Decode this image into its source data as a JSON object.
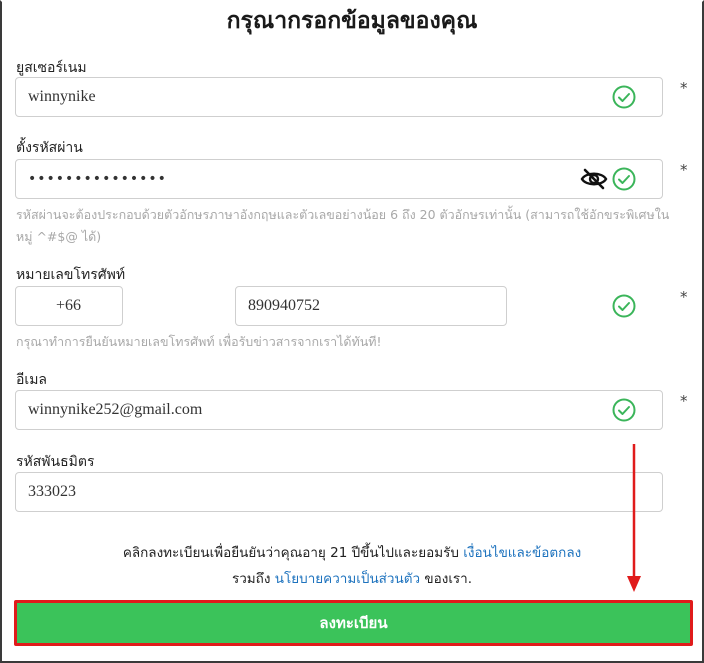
{
  "form": {
    "title": "กรุณากรอกข้อมูลของคุณ",
    "required_mark": "*",
    "username": {
      "label": "ยูสเซอร์เนม",
      "value": "winnynike",
      "icon": "check-circle-icon"
    },
    "password": {
      "label": "ตั้งรหัสผ่าน",
      "value": "•••••••••••••••",
      "toggle_icon": "eye-slash-icon",
      "icon": "check-circle-icon",
      "hint": "รหัสผ่านจะต้องประกอบด้วยตัวอักษรภาษาอังกฤษและตัวเลขอย่างน้อย 6 ถึง 20 ตัวอักษรเท่านั้น (สามารถใช้อักขระพิเศษในหมู่ ^#$@ ได้)"
    },
    "phone": {
      "label": "หมายเลขโทรศัพท์",
      "country_code": "+66",
      "value": "890940752",
      "icon": "check-circle-icon",
      "hint": "กรุณาทำการยืนยันหมายเลขโทรศัพท์ เพื่อรับข่าวสารจากเราได้ทันที!"
    },
    "email": {
      "label": "อีเมล",
      "value": "winnynike252@gmail.com",
      "icon": "check-circle-icon"
    },
    "referral": {
      "label": "รหัสพันธมิตร",
      "value": "333023"
    },
    "terms": {
      "line1_text": "คลิกลงทะเบียนเพื่อยืนยันว่าคุณอายุ 21 ปีขึ้นไปและยอมรับ",
      "terms_link": "เงื่อนไขและข้อตกลง",
      "line2_prefix": "รวมถึง",
      "privacy_link": "นโยบายความเป็นส่วนตัว",
      "line2_suffix": "ของเรา."
    },
    "submit_label": "ลงทะเบียน"
  },
  "colors": {
    "check_green": "#3bb55a",
    "button_green": "#3bc35a",
    "annotation_red": "#e01b1b",
    "link_blue": "#1e73be",
    "hint_gray": "#a8a8a8"
  }
}
